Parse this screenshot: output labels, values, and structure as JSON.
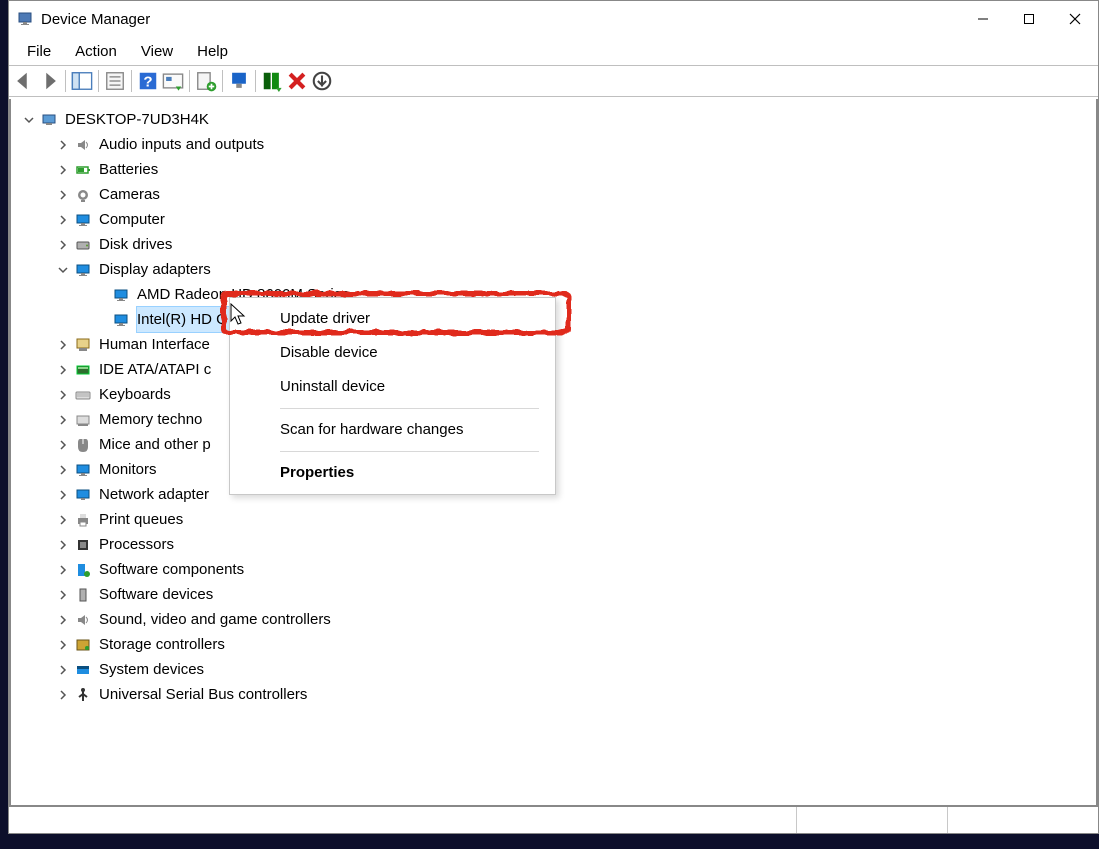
{
  "window": {
    "title": "Device Manager"
  },
  "menubar": [
    "File",
    "Action",
    "View",
    "Help"
  ],
  "tree": {
    "root": {
      "label": "DESKTOP-7UD3H4K",
      "icon": "computer"
    },
    "items": [
      {
        "label": "Audio inputs and outputs",
        "icon": "audio",
        "expand": "closed"
      },
      {
        "label": "Batteries",
        "icon": "battery",
        "expand": "closed"
      },
      {
        "label": "Cameras",
        "icon": "camera",
        "expand": "closed"
      },
      {
        "label": "Computer",
        "icon": "monitor",
        "expand": "closed"
      },
      {
        "label": "Disk drives",
        "icon": "disk",
        "expand": "closed"
      },
      {
        "label": "Display adapters",
        "icon": "monitor",
        "expand": "open",
        "children": [
          {
            "label": "AMD Radeon HD 8600M Series",
            "icon": "monitor"
          },
          {
            "label": "Intel(R) HD G",
            "icon": "monitor",
            "selected": true
          }
        ]
      },
      {
        "label": "Human Interface",
        "icon": "hid",
        "expand": "closed"
      },
      {
        "label": "IDE ATA/ATAPI c",
        "icon": "ide",
        "expand": "closed"
      },
      {
        "label": "Keyboards",
        "icon": "keyboard",
        "expand": "closed"
      },
      {
        "label": "Memory techno",
        "icon": "memory",
        "expand": "closed"
      },
      {
        "label": "Mice and other p",
        "icon": "mouse",
        "expand": "closed"
      },
      {
        "label": "Monitors",
        "icon": "monitor",
        "expand": "closed"
      },
      {
        "label": "Network adapter",
        "icon": "network",
        "expand": "closed"
      },
      {
        "label": "Print queues",
        "icon": "printer",
        "expand": "closed"
      },
      {
        "label": "Processors",
        "icon": "cpu",
        "expand": "closed"
      },
      {
        "label": "Software components",
        "icon": "swcomp",
        "expand": "closed"
      },
      {
        "label": "Software devices",
        "icon": "swdev",
        "expand": "closed"
      },
      {
        "label": "Sound, video and game controllers",
        "icon": "audio",
        "expand": "closed"
      },
      {
        "label": "Storage controllers",
        "icon": "storage",
        "expand": "closed"
      },
      {
        "label": "System devices",
        "icon": "system",
        "expand": "closed"
      },
      {
        "label": "Universal Serial Bus controllers",
        "icon": "usb",
        "expand": "closed"
      }
    ]
  },
  "context_menu": {
    "items": [
      {
        "label": "Update driver",
        "highlighted": true
      },
      {
        "label": "Disable device"
      },
      {
        "label": "Uninstall device"
      },
      {
        "sep": true
      },
      {
        "label": "Scan for hardware changes"
      },
      {
        "sep": true
      },
      {
        "label": "Properties",
        "bold": true
      }
    ]
  }
}
